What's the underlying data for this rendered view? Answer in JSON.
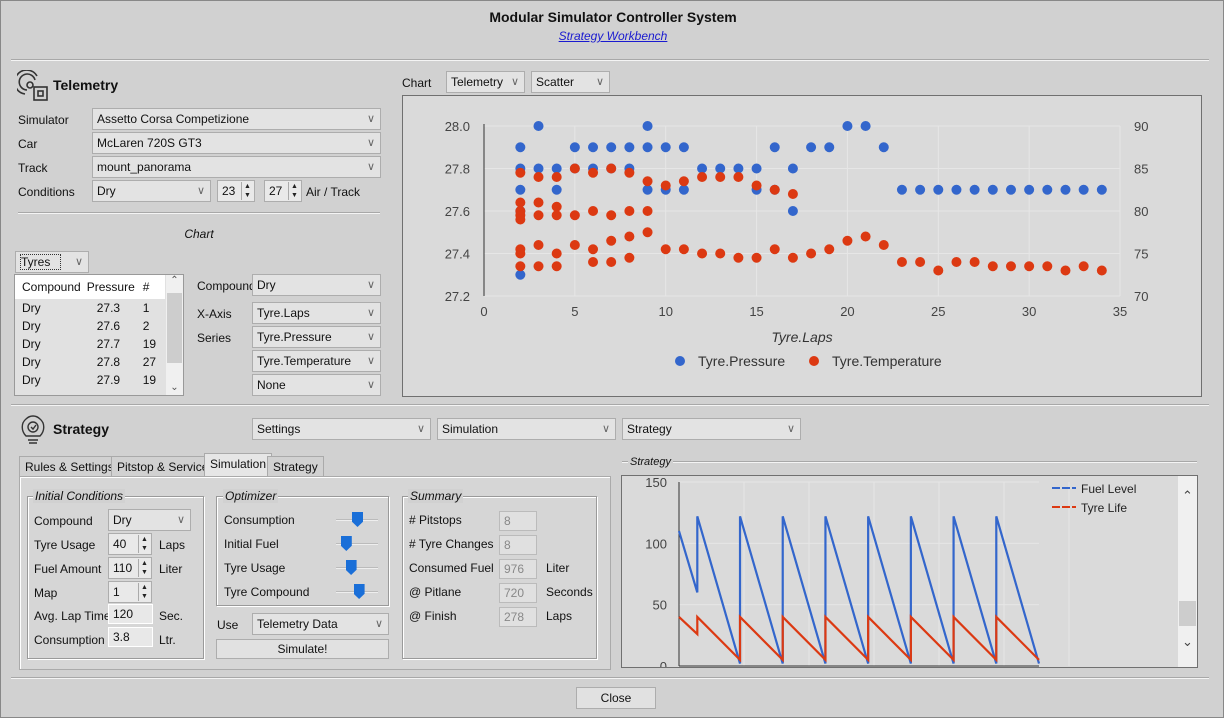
{
  "window": {
    "title": "Modular Simulator Controller System",
    "subtitle": "Strategy Workbench"
  },
  "telemetry": {
    "header": "Telemetry",
    "simulator_label": "Simulator",
    "simulator": "Assetto Corsa Competizione",
    "car_label": "Car",
    "car": "McLaren 720S GT3",
    "track_label": "Track",
    "track": "mount_panorama",
    "conditions_label": "Conditions",
    "conditions": "Dry",
    "air_temp": "23",
    "track_temp": "27",
    "air_track_label": "Air / Track",
    "chart_section_label": "Chart",
    "data_type": "Tyres",
    "table": {
      "columns": [
        "Compound",
        "Pressure",
        "#"
      ],
      "rows": [
        [
          "Dry",
          "27.3",
          "1"
        ],
        [
          "Dry",
          "27.6",
          "2"
        ],
        [
          "Dry",
          "27.7",
          "19"
        ],
        [
          "Dry",
          "27.8",
          "27"
        ],
        [
          "Dry",
          "27.9",
          "19"
        ]
      ]
    },
    "compound_label": "Compound",
    "compound": "Dry",
    "xaxis_label": "X-Axis",
    "xaxis": "Tyre.Laps",
    "series_label": "Series",
    "series1": "Tyre.Pressure",
    "series2": "Tyre.Temperature",
    "series3": "None"
  },
  "chart_controls": {
    "label": "Chart",
    "source": "Telemetry",
    "type": "Scatter"
  },
  "strategy": {
    "header": "Strategy",
    "menu_settings": "Settings",
    "menu_simulation": "Simulation",
    "menu_strategy": "Strategy",
    "tabs": [
      {
        "label": "Rules & Settings"
      },
      {
        "label": "Pitstop & Service"
      },
      {
        "label": "Simulation",
        "active": true
      },
      {
        "label": "Strategy"
      }
    ],
    "initial": {
      "title": "Initial Conditions",
      "compound_label": "Compound",
      "compound": "Dry",
      "tyre_usage_label": "Tyre Usage",
      "tyre_usage": "40",
      "tyre_usage_unit": "Laps",
      "fuel_label": "Fuel Amount",
      "fuel": "110",
      "fuel_unit": "Liter",
      "map_label": "Map",
      "map": "1",
      "lap_time_label": "Avg. Lap Time",
      "lap_time": "120",
      "lap_time_unit": "Sec.",
      "consumption_label": "Consumption",
      "consumption": "3.8",
      "consumption_unit": "Ltr."
    },
    "optimizer": {
      "title": "Optimizer",
      "sliders": [
        {
          "label": "Consumption",
          "value": 0.5
        },
        {
          "label": "Initial Fuel",
          "value": 0.15
        },
        {
          "label": "Tyre Usage",
          "value": 0.3
        },
        {
          "label": "Tyre Compound",
          "value": 0.55
        }
      ],
      "use_label": "Use",
      "use": "Telemetry Data",
      "simulate": "Simulate!"
    },
    "summary": {
      "title": "Summary",
      "pitstops_label": "# Pitstops",
      "pitstops": "8",
      "tyre_changes_label": "# Tyre Changes",
      "tyre_changes": "8",
      "fuel_label": "Consumed Fuel",
      "fuel": "976",
      "fuel_unit": "Liter",
      "pitlane_label": "@ Pitlane",
      "pitlane": "720",
      "pitlane_unit": "Seconds",
      "finish_label": "@ Finish",
      "finish": "278",
      "finish_unit": "Laps"
    },
    "chart_group_label": "Strategy"
  },
  "close": "Close",
  "colors": {
    "blue": "#3366cc",
    "red": "#dc3912"
  },
  "chart_data": [
    {
      "type": "scatter",
      "title": "",
      "xlabel": "Tyre.Laps",
      "ylabel": "",
      "xlim": [
        0,
        35
      ],
      "ylim": [
        27.2,
        28.0
      ],
      "y2lim": [
        70,
        90
      ],
      "xticks": [
        "0",
        "5",
        "10",
        "15",
        "20",
        "25",
        "30",
        "35"
      ],
      "yticks": [
        "27.2",
        "27.4",
        "27.6",
        "27.8",
        "28.0"
      ],
      "y2ticks": [
        "70",
        "75",
        "80",
        "85",
        "90"
      ],
      "legend": "bottom",
      "series": [
        {
          "name": "Tyre.Pressure",
          "axis": "left",
          "points": [
            [
              2,
              27.3
            ],
            [
              2,
              27.6
            ],
            [
              2,
              27.7
            ],
            [
              2,
              27.8
            ],
            [
              2,
              27.9
            ],
            [
              3,
              28.0
            ],
            [
              3,
              27.8
            ],
            [
              4,
              27.8
            ],
            [
              4,
              27.7
            ],
            [
              5,
              27.9
            ],
            [
              5,
              27.8
            ],
            [
              6,
              27.9
            ],
            [
              6,
              27.8
            ],
            [
              7,
              27.9
            ],
            [
              7,
              27.8
            ],
            [
              8,
              27.9
            ],
            [
              8,
              27.8
            ],
            [
              9,
              28.0
            ],
            [
              9,
              27.9
            ],
            [
              9,
              27.7
            ],
            [
              10,
              27.9
            ],
            [
              10,
              27.7
            ],
            [
              11,
              27.9
            ],
            [
              11,
              27.7
            ],
            [
              12,
              27.8
            ],
            [
              13,
              27.8
            ],
            [
              14,
              27.8
            ],
            [
              15,
              27.8
            ],
            [
              15,
              27.7
            ],
            [
              16,
              27.9
            ],
            [
              16,
              27.7
            ],
            [
              17,
              27.8
            ],
            [
              17,
              27.6
            ],
            [
              18,
              27.9
            ],
            [
              19,
              27.9
            ],
            [
              20,
              28.0
            ],
            [
              21,
              28.0
            ],
            [
              22,
              27.9
            ],
            [
              23,
              27.7
            ],
            [
              24,
              27.7
            ],
            [
              25,
              27.7
            ],
            [
              26,
              27.7
            ],
            [
              27,
              27.7
            ],
            [
              28,
              27.7
            ],
            [
              29,
              27.7
            ],
            [
              30,
              27.7
            ],
            [
              31,
              27.7
            ],
            [
              32,
              27.7
            ],
            [
              33,
              27.7
            ],
            [
              34,
              27.7
            ]
          ]
        },
        {
          "name": "Tyre.Temperature",
          "axis": "right",
          "points": [
            [
              2,
              84.5
            ],
            [
              2,
              81
            ],
            [
              2,
              80
            ],
            [
              2,
              79.5
            ],
            [
              2,
              79
            ],
            [
              2,
              75.5
            ],
            [
              2,
              75
            ],
            [
              2,
              73.5
            ],
            [
              3,
              84
            ],
            [
              3,
              81
            ],
            [
              3,
              79.5
            ],
            [
              3,
              76
            ],
            [
              3,
              73.5
            ],
            [
              4,
              84
            ],
            [
              4,
              80.5
            ],
            [
              4,
              79.5
            ],
            [
              4,
              75
            ],
            [
              4,
              73.5
            ],
            [
              5,
              85
            ],
            [
              5,
              79.5
            ],
            [
              5,
              76
            ],
            [
              6,
              84.5
            ],
            [
              6,
              80
            ],
            [
              6,
              75.5
            ],
            [
              6,
              74
            ],
            [
              7,
              85
            ],
            [
              7,
              79.5
            ],
            [
              7,
              76.5
            ],
            [
              7,
              74
            ],
            [
              8,
              84.5
            ],
            [
              8,
              80
            ],
            [
              8,
              77
            ],
            [
              8,
              74.5
            ],
            [
              9,
              83.5
            ],
            [
              9,
              80
            ],
            [
              9,
              77.5
            ],
            [
              10,
              83
            ],
            [
              10,
              75.5
            ],
            [
              11,
              83.5
            ],
            [
              11,
              75.5
            ],
            [
              12,
              84
            ],
            [
              12,
              75
            ],
            [
              13,
              84
            ],
            [
              13,
              75
            ],
            [
              14,
              84
            ],
            [
              14,
              74.5
            ],
            [
              15,
              83
            ],
            [
              15,
              74.5
            ],
            [
              16,
              82.5
            ],
            [
              16,
              75.5
            ],
            [
              17,
              82
            ],
            [
              17,
              74.5
            ],
            [
              18,
              75
            ],
            [
              19,
              75.5
            ],
            [
              20,
              76.5
            ],
            [
              21,
              77
            ],
            [
              22,
              76
            ],
            [
              23,
              74
            ],
            [
              24,
              74
            ],
            [
              25,
              73
            ],
            [
              26,
              74
            ],
            [
              27,
              74
            ],
            [
              28,
              73.5
            ],
            [
              29,
              73.5
            ],
            [
              30,
              73.5
            ],
            [
              31,
              73.5
            ],
            [
              32,
              73
            ],
            [
              33,
              73.5
            ],
            [
              34,
              73
            ]
          ]
        }
      ]
    },
    {
      "type": "line",
      "title": "Strategy",
      "ylim": [
        0,
        150
      ],
      "yticks": [
        "0",
        "50",
        "100",
        "150"
      ],
      "legend": "top-right",
      "series": [
        {
          "name": "Fuel Level",
          "points": [
            [
              0,
              110
            ],
            [
              3,
              60
            ],
            [
              3,
              122
            ],
            [
              10,
              2
            ],
            [
              10,
              122
            ],
            [
              17,
              2
            ],
            [
              17,
              122
            ],
            [
              24,
              2
            ],
            [
              24,
              122
            ],
            [
              31,
              2
            ],
            [
              31,
              122
            ],
            [
              38,
              2
            ],
            [
              38,
              122
            ],
            [
              45,
              2
            ],
            [
              45,
              122
            ],
            [
              52,
              2
            ],
            [
              52,
              122
            ],
            [
              59,
              2
            ]
          ]
        },
        {
          "name": "Tyre Life",
          "points": [
            [
              0,
              40
            ],
            [
              3,
              26
            ],
            [
              3,
              40
            ],
            [
              10,
              5
            ],
            [
              10,
              40
            ],
            [
              17,
              5
            ],
            [
              17,
              40
            ],
            [
              24,
              5
            ],
            [
              24,
              40
            ],
            [
              31,
              5
            ],
            [
              31,
              40
            ],
            [
              38,
              5
            ],
            [
              38,
              40
            ],
            [
              45,
              5
            ],
            [
              45,
              40
            ],
            [
              52,
              5
            ],
            [
              52,
              40
            ],
            [
              59,
              5
            ]
          ]
        }
      ]
    }
  ]
}
